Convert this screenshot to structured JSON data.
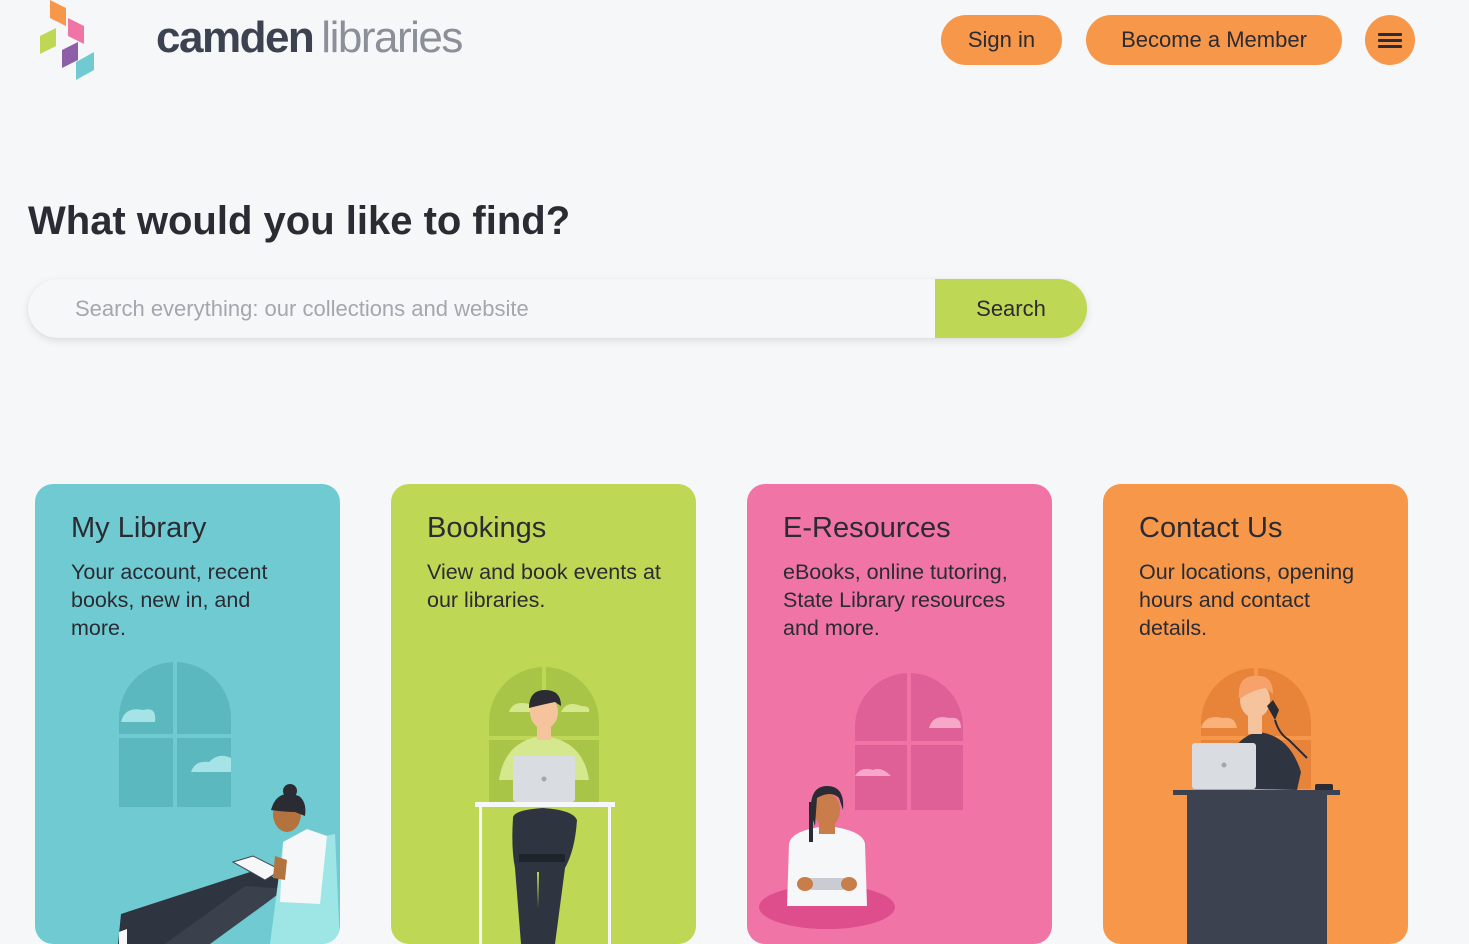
{
  "header": {
    "logo": {
      "word_bold": "camden",
      "word_light": "libraries"
    },
    "signin_label": "Sign in",
    "member_label": "Become a Member",
    "menu_icon": "hamburger-icon"
  },
  "hero": {
    "title": "What would you like to find?",
    "search_placeholder": "Search everything: our collections and website",
    "search_label": "Search"
  },
  "cards": [
    {
      "title": "My Library",
      "description": "Your account, recent books, new in, and more.",
      "color": "#6fcbd1"
    },
    {
      "title": "Bookings",
      "description": "View and book events at our libraries.",
      "color": "#bed754"
    },
    {
      "title": "E-Resources",
      "description": "eBooks, online tutoring, State Library resources and more.",
      "color": "#f074a6"
    },
    {
      "title": "Contact Us",
      "description": "Our locations, opening hours and contact details.",
      "color": "#f7974a"
    }
  ],
  "colors": {
    "accent_orange": "#f7974a",
    "accent_green": "#bed754",
    "accent_teal": "#6fcbd1",
    "accent_pink": "#f074a6",
    "text": "#2b2b33"
  }
}
